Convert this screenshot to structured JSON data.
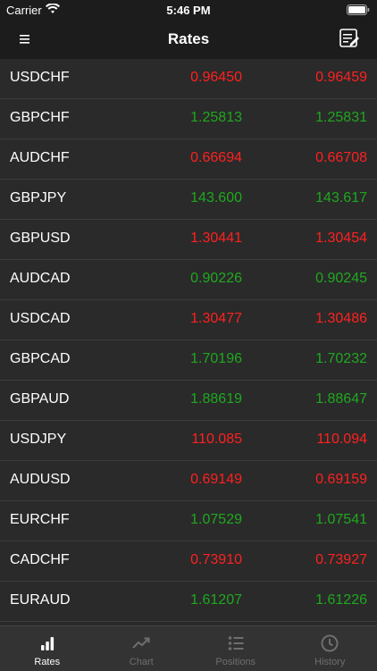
{
  "status_bar": {
    "carrier": "Carrier",
    "time": "5:46 PM",
    "wifi_icon": "wifi-icon",
    "battery_icon": "battery-icon"
  },
  "nav": {
    "title": "Rates",
    "menu_icon": "hamburger-menu-icon",
    "edit_icon": "edit-list-icon"
  },
  "colors": {
    "down": "#ff2020",
    "up": "#1fa81f",
    "background": "#2a2a2a",
    "bar": "#1c1c1c"
  },
  "rates": [
    {
      "symbol": "USDCHF",
      "bid": "0.96450",
      "ask": "0.96459",
      "direction": "down"
    },
    {
      "symbol": "GBPCHF",
      "bid": "1.25813",
      "ask": "1.25831",
      "direction": "up"
    },
    {
      "symbol": "AUDCHF",
      "bid": "0.66694",
      "ask": "0.66708",
      "direction": "down"
    },
    {
      "symbol": "GBPJPY",
      "bid": "143.600",
      "ask": "143.617",
      "direction": "up"
    },
    {
      "symbol": "GBPUSD",
      "bid": "1.30441",
      "ask": "1.30454",
      "direction": "down"
    },
    {
      "symbol": "AUDCAD",
      "bid": "0.90226",
      "ask": "0.90245",
      "direction": "up"
    },
    {
      "symbol": "USDCAD",
      "bid": "1.30477",
      "ask": "1.30486",
      "direction": "down"
    },
    {
      "symbol": "GBPCAD",
      "bid": "1.70196",
      "ask": "1.70232",
      "direction": "up"
    },
    {
      "symbol": "GBPAUD",
      "bid": "1.88619",
      "ask": "1.88647",
      "direction": "up"
    },
    {
      "symbol": "USDJPY",
      "bid": "110.085",
      "ask": "110.094",
      "direction": "down"
    },
    {
      "symbol": "AUDUSD",
      "bid": "0.69149",
      "ask": "0.69159",
      "direction": "down"
    },
    {
      "symbol": "EURCHF",
      "bid": "1.07529",
      "ask": "1.07541",
      "direction": "up"
    },
    {
      "symbol": "CADCHF",
      "bid": "0.73910",
      "ask": "0.73927",
      "direction": "down"
    },
    {
      "symbol": "EURAUD",
      "bid": "1.61207",
      "ask": "1.61226",
      "direction": "up"
    }
  ],
  "tabs": [
    {
      "label": "Rates",
      "icon": "bar-chart-icon",
      "active": true
    },
    {
      "label": "Chart",
      "icon": "trending-up-icon",
      "active": false
    },
    {
      "label": "Positions",
      "icon": "list-icon",
      "active": false
    },
    {
      "label": "History",
      "icon": "clock-icon",
      "active": false
    }
  ]
}
